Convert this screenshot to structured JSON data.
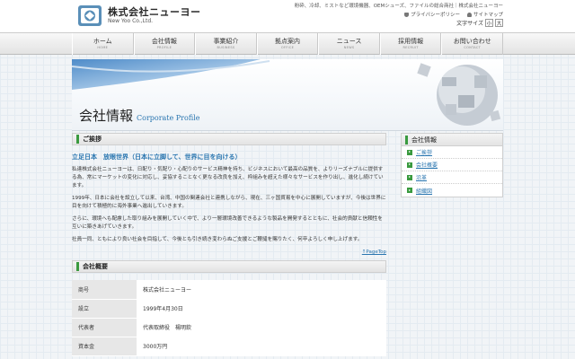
{
  "header": {
    "company_jp": "株式会社ニューヨー",
    "company_en": "New Yoo Co.,Ltd.",
    "tagline": "粉砕、冷却、ミストなど環境機器、OEMシューズ、ファイルの総合商社｜株式会社ニューヨー",
    "privacy_label": "プライバシーポリシー",
    "sitemap_label": "サイトマップ",
    "fontsize_label": "文字サイズ",
    "fontsize_small": "小",
    "fontsize_large": "大"
  },
  "nav": [
    {
      "jp": "ホーム",
      "en": "HOME"
    },
    {
      "jp": "会社情報",
      "en": "PROFILE"
    },
    {
      "jp": "事業紹介",
      "en": "BUSINESS"
    },
    {
      "jp": "拠点案内",
      "en": "OFFICE"
    },
    {
      "jp": "ニュース",
      "en": "NEWS"
    },
    {
      "jp": "採用情報",
      "en": "RECRUIT"
    },
    {
      "jp": "お問い合わせ",
      "en": "CONTACT"
    }
  ],
  "banner": {
    "title_jp": "会社情報",
    "title_en": "Corporate Profile"
  },
  "greeting": {
    "heading": "ご挨拶",
    "lead": "立足日本　放眼世界（日本に立脚して、世界に目を向ける）",
    "paragraphs": [
      "私達株式会社ニューヨーは、日配り・気配り・心配りのサービス精神を持ち、ビジネスにおいて最高の品質を、よりリーズナブルに提供する為、常にマーケットの変化に対応し、妥協することなく更なる改良を加え、枠組みを超えた様々なサービスを作り出し、進化し続けています。",
      "1999年、日本に会社を設立して以来、台湾、中国の関連会社と連携しながら、現在、三ヶ国貿易を中心に展開していますが、今後は世界に目を向けて積極的に海外事業へ進出していきます。",
      "さらに、環境へも配慮した取り組みを展開していく中で、より一層環境改善できるような製品を開発するとともに、社会的貢献と信頼性を互いに築きあげていきます。",
      "社員一同、ともにより良い社会を目指して、今後とも引き続き変わらぬご支援とご鞭撻を賜りたく、何卒よろしく申し上げます。"
    ],
    "pagetop": "↑PageTop"
  },
  "overview": {
    "heading": "会社概要",
    "rows": [
      {
        "key": "商号",
        "value": "株式会社ニューヨー"
      },
      {
        "key": "設立",
        "value": "1999年4月30日"
      },
      {
        "key": "代表者",
        "value": "代表取締役　楊明欽"
      },
      {
        "key": "資本金",
        "value": "3000万円"
      }
    ]
  },
  "sidebar": {
    "heading": "会社情報",
    "items": [
      "ご挨拶",
      "会社概要",
      "沿革",
      "組織図"
    ]
  },
  "colors": {
    "accent": "#3a9a3f",
    "link": "#2a76b0"
  }
}
